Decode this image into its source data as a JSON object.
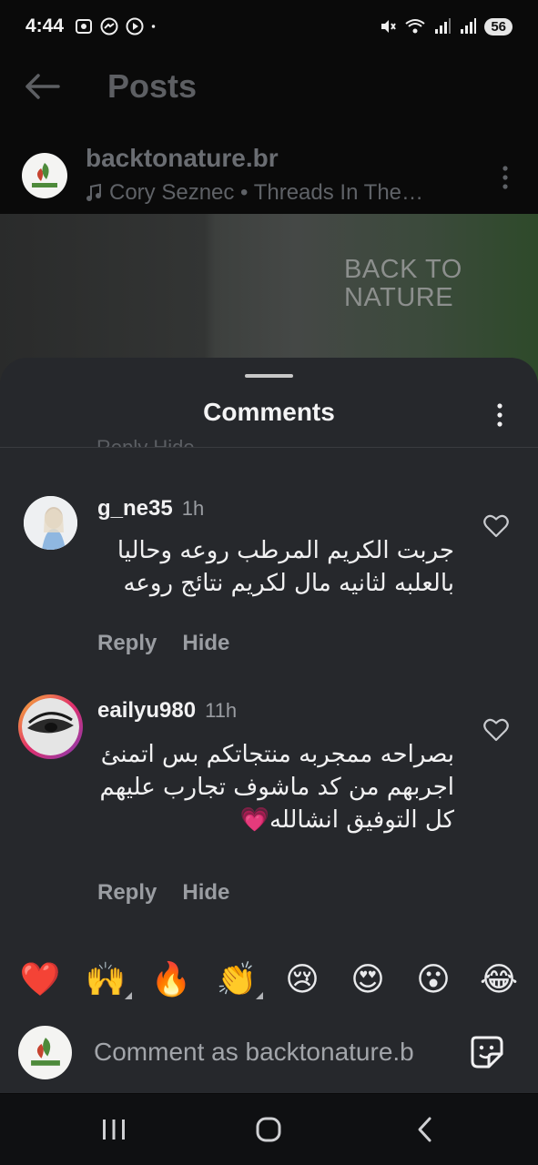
{
  "status_bar": {
    "time": "4:44",
    "battery": "56",
    "icons_left": [
      "screen-record-icon",
      "messenger-icon",
      "media-icon",
      "dot-icon"
    ],
    "icons_right": [
      "mute-icon",
      "wifi-icon",
      "signal-icon",
      "signal-icon"
    ]
  },
  "header": {
    "title": "Posts",
    "back_icon": "arrow-left-icon"
  },
  "post": {
    "username": "backtonature.br",
    "audio": "Cory Seznec • Threads In The…",
    "image_text": "BACK TO NATURE"
  },
  "comments_sheet": {
    "title": "Comments",
    "cut_off_text": "Reply   Hide",
    "comments": [
      {
        "username": "g_ne35",
        "time": "1h",
        "text": "جربت الكريم المرطب روعه وحاليا بالعلبه لثانيه مال لكريم نتائج روعه",
        "reply_label": "Reply",
        "hide_label": "Hide"
      },
      {
        "username": "eailyu980",
        "time": "11h",
        "text": "بصراحه ممجربه منتجاتكم بس اتمنئ اجربهم من كد ماشوف تجارب عليهم كل التوفيق انشالله💗",
        "reply_label": "Reply",
        "hide_label": "Hide"
      }
    ]
  },
  "emoji_bar": [
    "❤️",
    "🙌",
    "🔥",
    "👏",
    "😢",
    "😍",
    "😮",
    "😂"
  ],
  "comment_input": {
    "placeholder": "Comment as backtonature.b"
  },
  "colors": {
    "background": "#0a0a0a",
    "sheet": "#26282c",
    "text_primary": "#f1f1f2",
    "text_secondary": "#9a9da2",
    "heart_pink": "#f0568e"
  }
}
